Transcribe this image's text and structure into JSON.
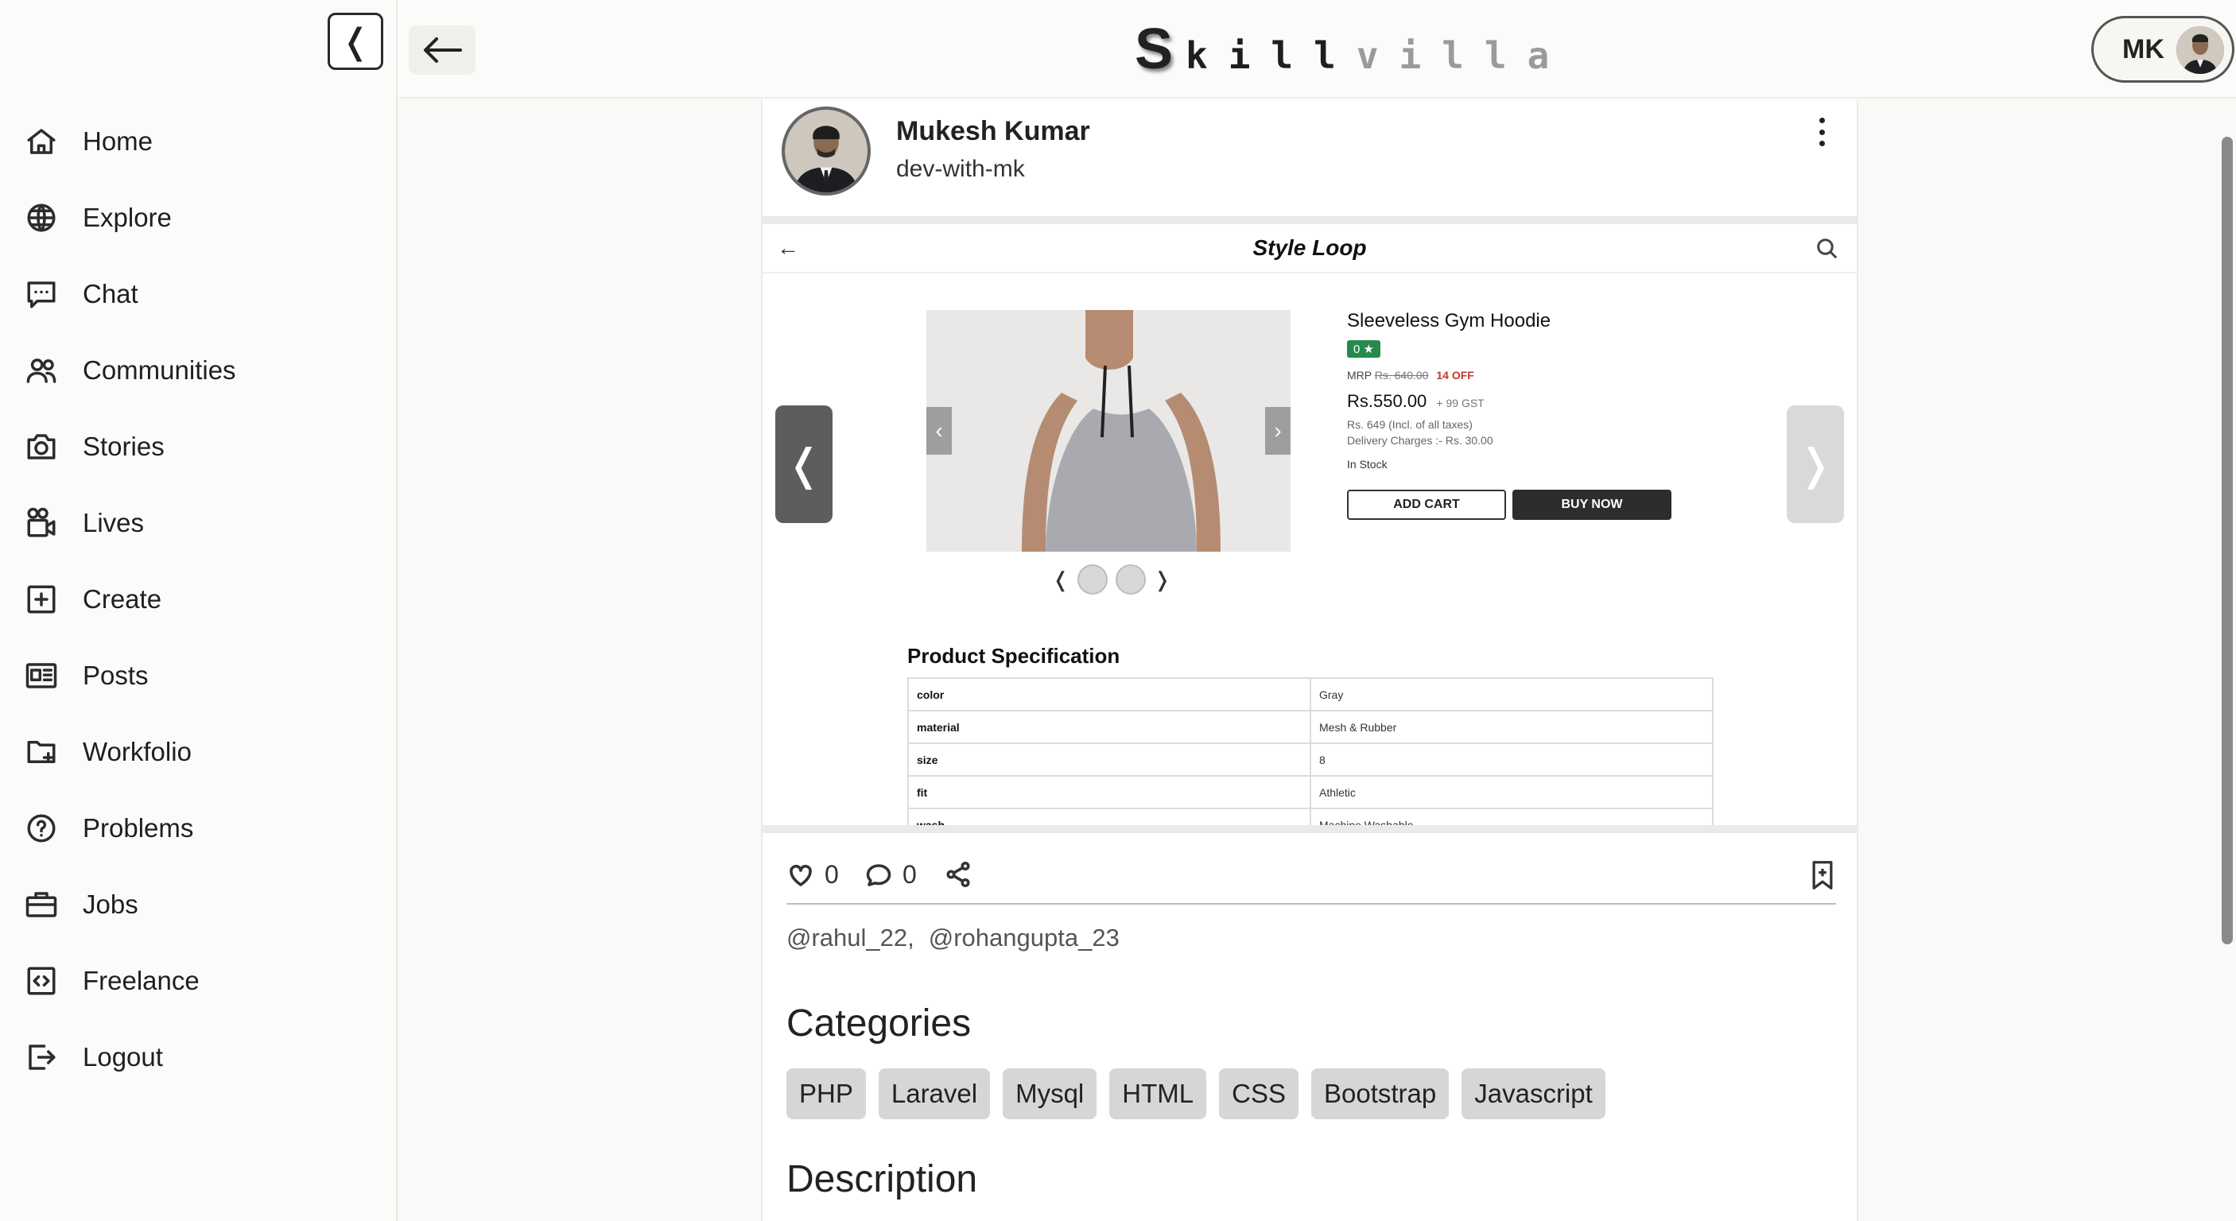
{
  "sidebar": {
    "collapse_glyph": "❬",
    "items": [
      {
        "label": "Home",
        "icon": "home-icon"
      },
      {
        "label": "Explore",
        "icon": "globe-icon"
      },
      {
        "label": "Chat",
        "icon": "chat-icon"
      },
      {
        "label": "Communities",
        "icon": "users-icon"
      },
      {
        "label": "Stories",
        "icon": "camera-icon"
      },
      {
        "label": "Lives",
        "icon": "video-icon"
      },
      {
        "label": "Create",
        "icon": "plus-square-icon"
      },
      {
        "label": "Posts",
        "icon": "posts-icon"
      },
      {
        "label": "Workfolio",
        "icon": "folder-plus-icon"
      },
      {
        "label": "Problems",
        "icon": "question-circle-icon"
      },
      {
        "label": "Jobs",
        "icon": "briefcase-icon"
      },
      {
        "label": "Freelance",
        "icon": "code-icon"
      },
      {
        "label": "Logout",
        "icon": "logout-icon"
      }
    ]
  },
  "header": {
    "logo_first": "S",
    "logo_dark": "kill",
    "logo_light": "villa",
    "profile_initials": "MK"
  },
  "post": {
    "author_name": "Mukesh Kumar",
    "author_handle": "dev-with-mk",
    "shop": {
      "back_glyph": "←",
      "title": "Style Loop",
      "product_name": "Sleeveless Gym Hoodie",
      "rating": "0 ★",
      "mrp_label": "MRP",
      "mrp_value": "Rs. 640.00",
      "off": "14 OFF",
      "price": "Rs.550.00",
      "gst": "+ 99 GST",
      "incl_taxes": "Rs. 649 (Incl. of all taxes)",
      "delivery": "Delivery Charges :- Rs. 30.00",
      "stock": "In Stock",
      "add_cart": "ADD CART",
      "buy_now": "BUY NOW",
      "carousel_left": "❬",
      "carousel_right": "❭",
      "thumb_prev": "❬",
      "thumb_next": "❭",
      "spec_title": "Product Specification",
      "specs": [
        {
          "key": "color",
          "value": "Gray"
        },
        {
          "key": "material",
          "value": "Mesh & Rubber"
        },
        {
          "key": "size",
          "value": "8"
        },
        {
          "key": "fit",
          "value": "Athletic"
        },
        {
          "key": "wash",
          "value": "Machine Washable"
        }
      ]
    },
    "likes": "0",
    "comments": "0",
    "mentions": [
      "@rahul_22,",
      "@rohangupta_23"
    ],
    "categories_title": "Categories",
    "categories": [
      "PHP",
      "Laravel",
      "Mysql",
      "HTML",
      "CSS",
      "Bootstrap",
      "Javascript"
    ],
    "description_title": "Description"
  }
}
